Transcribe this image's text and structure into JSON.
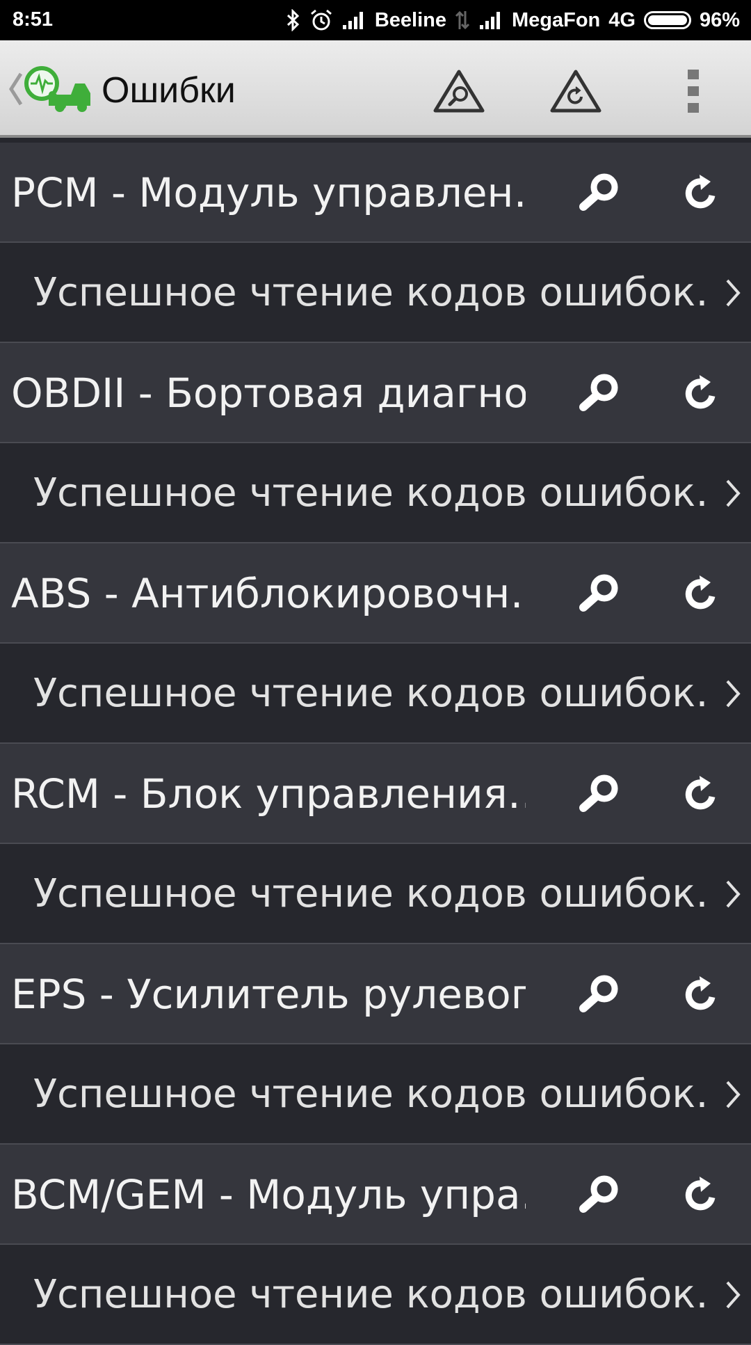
{
  "status_bar": {
    "time": "8:51",
    "carrier1": "Beeline",
    "carrier2": "MegaFon",
    "network": "4G",
    "battery": "96%",
    "icons": [
      "bluetooth-icon",
      "alarm-icon",
      "signal-icon",
      "data-icon",
      "signal-icon",
      "battery-icon"
    ]
  },
  "toolbar": {
    "title": "Ошибки",
    "icons": [
      "back-chevron-icon",
      "app-logo-icon",
      "scan-all-icon",
      "clear-all-icon",
      "more-icon"
    ],
    "accent": "#3fae3a"
  },
  "modules": [
    {
      "name": "PCM - Модуль управлен…",
      "status": "Успешное чтение кодов ошибок…"
    },
    {
      "name": "OBDII - Бортовая диагно…",
      "status": "Успешное чтение кодов ошибок…"
    },
    {
      "name": "ABS - Антиблокировочн…",
      "status": "Успешное чтение кодов ошибок…"
    },
    {
      "name": "RCM - Блок управления…",
      "status": "Успешное чтение кодов ошибок…"
    },
    {
      "name": "EPS - Усилитель рулевог…",
      "status": "Успешное чтение кодов ошибок…"
    },
    {
      "name": "BCM/GEM - Модуль упра…",
      "status": "Успешное чтение кодов ошибок…"
    }
  ],
  "row_icons": [
    "search-icon",
    "reset-icon",
    "chevron-right-icon"
  ]
}
